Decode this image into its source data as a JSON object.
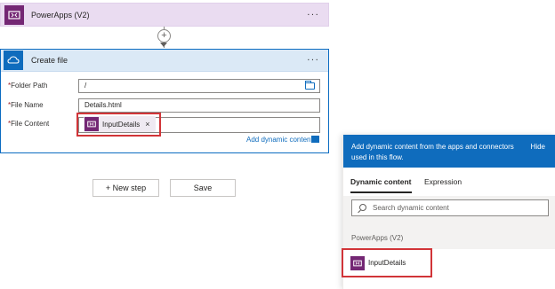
{
  "trigger": {
    "title": "PowerApps (V2)",
    "more": "···",
    "icon": "powerapps-icon"
  },
  "connector": {
    "plus": "+"
  },
  "card": {
    "title": "Create file",
    "more": "···",
    "icon": "onedrive-cloud-icon",
    "fields": {
      "folder_path": {
        "label": "Folder Path",
        "required": "*",
        "value": "/"
      },
      "file_name": {
        "label": "File Name",
        "required": "*",
        "value": "Details.html"
      },
      "file_content": {
        "label": "File Content",
        "required": "*",
        "token": "InputDetails",
        "token_remove": "×"
      }
    },
    "add_dynamic": "Add dynamic content"
  },
  "buttons": {
    "new_step": "+ New step",
    "save": "Save"
  },
  "panel": {
    "description": "Add dynamic content from the apps and connectors used in this flow.",
    "hide": "Hide",
    "tabs": [
      "Dynamic content",
      "Expression"
    ],
    "search_placeholder": "Search dynamic content",
    "section": "PowerApps (V2)",
    "item": "InputDetails"
  },
  "colors": {
    "accent": "#0f6cbd",
    "powerapps": "#742774",
    "highlight": "#d13438"
  }
}
